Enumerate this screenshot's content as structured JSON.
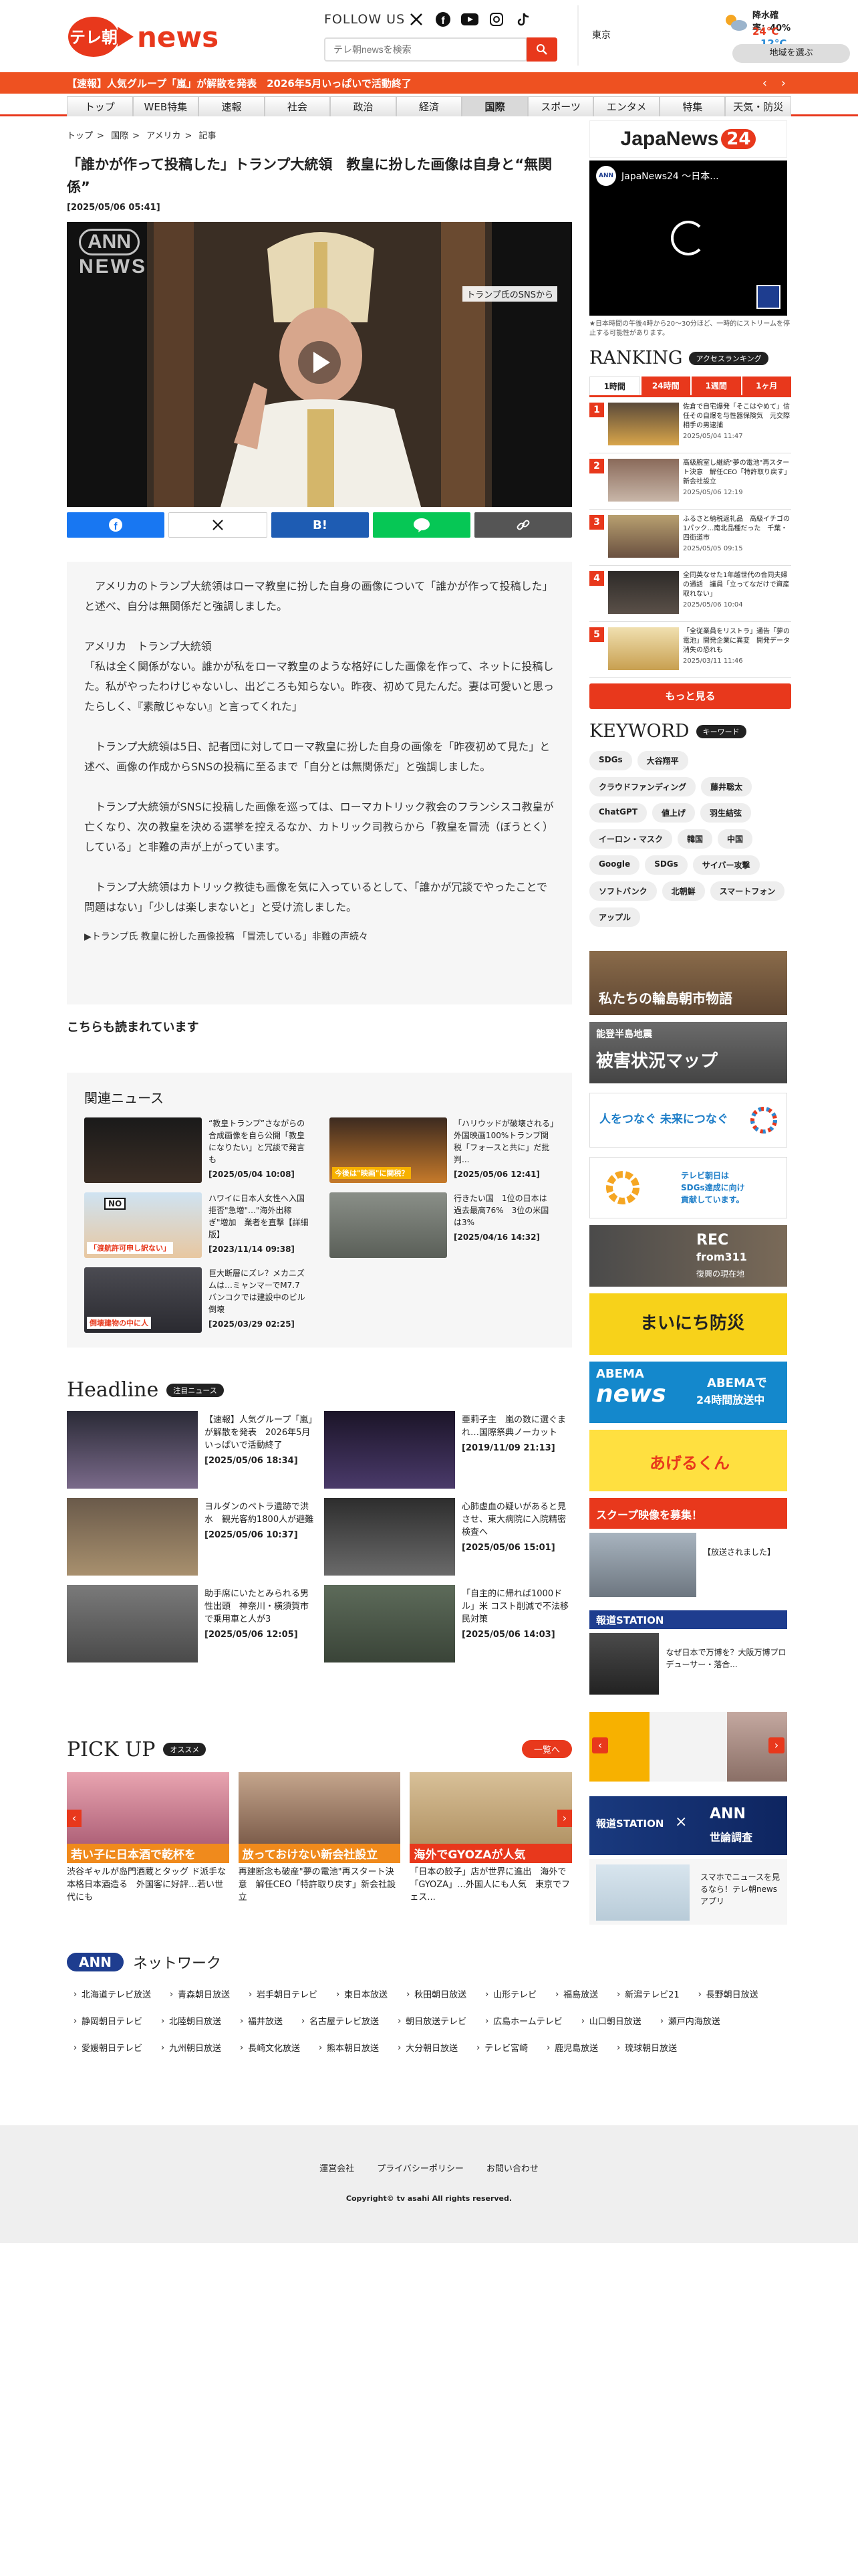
{
  "header": {
    "logo_text": "テレ朝",
    "logo_news": "news",
    "follow": "FOLLOW US",
    "search_placeholder": "テレ朝newsを検索",
    "weather": {
      "city": "東京",
      "rain_label": "降水確率：",
      "rain": "40%",
      "high": "24°C",
      "low": "12°C",
      "region_btn": "地域を選ぶ"
    }
  },
  "ticker": {
    "text": "【速報】人気グループ「嵐」が解散を発表　2026年5月いっぱいで活動終了"
  },
  "nav": [
    "トップ",
    "WEB特集",
    "速報",
    "社会",
    "政治",
    "経済",
    "国際",
    "スポーツ",
    "エンタメ",
    "特集",
    "天気・防災"
  ],
  "nav_active": "国際",
  "breadcrumb": [
    "トップ",
    "国際",
    "アメリカ",
    "記事"
  ],
  "article": {
    "title": "「誰かが作って投稿した」トランプ大統領　教皇に扮した画像は自身と“無関係”",
    "date": "[2025/05/06 05:41]",
    "video_logo": "ANN",
    "video_logo2": "NEWS",
    "video_caption": "トランプ氏のSNSから",
    "p1": "　アメリカのトランプ大統領はローマ教皇に扮した自身の画像について「誰かが作って投稿した」と述べ、自分は無関係だと強調しました。",
    "p2a": "アメリカ　トランプ大統領",
    "p2b": "「私は全く関係がない。誰かが私をローマ教皇のような格好にした画像を作って、ネットに投稿した。私がやったわけじゃないし、出どころも知らない。昨夜、初めて見たんだ。妻は可愛いと思ったらしく、『素敵じゃない』と言ってくれた」",
    "p3": "　トランプ大統領は5日、記者団に対してローマ教皇に扮した自身の画像を「昨夜初めて見た」と述べ、画像の作成からSNSの投稿に至るまで「自分とは無関係だ」と強調しました。",
    "p4": "　トランプ大統領がSNSに投稿した画像を巡っては、ローマカトリック教会のフランシスコ教皇が亡くなり、次の教皇を決める選挙を控えるなか、カトリック司教らから「教皇を冒涜（ぼうとく）している」と非難の声が上がっています。",
    "p5": "　トランプ大統領はカトリック教徒も画像を気に入っているとして、「誰かが冗談でやったことで問題はない」「少しは楽しまないと」と受け流しました。",
    "link": "▶トランプ氏 教皇に扮した画像投稿 「冒涜している」非難の声続々"
  },
  "also_read": "こちらも読まれています",
  "related": {
    "title": "関連ニュース",
    "items": [
      {
        "text": "“教皇トランプ”さながらの合成画像を自ら公開「教皇になりたい」と冗談で発言も",
        "date": "[2025/05/04 10:08]"
      },
      {
        "text": "「ハリウッドが破壊される」外国映画100%トランプ関税「フォースと共に」だ批判...",
        "date": "[2025/05/06 12:41]",
        "overlay": "今後は\"映画\"に関税？"
      },
      {
        "text": "ハワイに日本人女性へ入国拒否\"急増\"…\"海外出稼ぎ\"増加　業者を直撃【詳細版】",
        "date": "[2023/11/14 09:38]",
        "overlay": "「渡航許可申し訳ない」",
        "overlay2": "NO"
      },
      {
        "text": "行きたい国　1位の日本は過去最高76%　3位の米国は3%",
        "date": "[2025/04/16 14:32]",
        "overlay": ""
      },
      {
        "text": "巨大断層にズレ？メカニズムは…ミャンマーでM7.7　バンコクでは建設中のビル倒壊",
        "date": "[2025/03/29 02:25]",
        "overlay": "倒壊建物の中に人"
      }
    ]
  },
  "headline": {
    "title": "Headline",
    "badge": "注目ニュース",
    "items": [
      {
        "text": "【速報】人気グループ「嵐」が解散を発表　2026年5月いっぱいで活動終了",
        "date": "[2025/05/06 18:34]"
      },
      {
        "text": "亜莉子主　嵐の数に選ぐまれ…国際祭典ノーカット",
        "date": "[2019/11/09 21:13]"
      },
      {
        "text": "ヨルダンのペトラ遺跡で洪水　観光客約1800人が避難",
        "date": "[2025/05/06 10:37]"
      },
      {
        "text": "心肺虚血の疑いがあると見させ、東大病院に入院精密検査へ",
        "date": "[2025/05/06 15:01]"
      },
      {
        "text": "助手席にいたとみられる男性出頭　神奈川・横須賀市で乗用車と人が3",
        "date": "[2025/05/06 12:05]"
      },
      {
        "text": "「自主的に帰れば1000ドル」米 コスト削減で不法移民対策",
        "date": "[2025/05/06 14:03]"
      }
    ]
  },
  "pickup": {
    "title": "PICK UP",
    "badge": "オススメ",
    "more": "一覧へ",
    "items": [
      {
        "text": "渋谷ギャルが岛門酒蔵とタッグ ド派手な本格日本酒造る　外国客に好評…若い世代にも",
        "overlay": "若い子に日本酒で乾杯を"
      },
      {
        "text": "再建断念も破産\"夢の電池\"再スタート決意　解任CEO「特許取り戻す」新会社設立",
        "overlay": "放っておけない新会社設立"
      },
      {
        "text": "「日本の餃子」店が世界に進出　海外で「GYOZA」…外国人にも人気　東京でフェス...",
        "overlay": "海外でGYOZAが人気"
      }
    ]
  },
  "sidebar": {
    "jn_title": "JapaNews",
    "jn_num": "24",
    "jn_video": "JapaNews24 〜日本...",
    "jn_note": "★日本時間の午後4時から20〜30分ほど、一時的にストリームを停止する可能性があります。",
    "ranking": "RANKING",
    "ranking_badge": "アクセスランキング",
    "tabs": [
      "1時間",
      "24時間",
      "1週間",
      "1ヶ月"
    ],
    "ranks": [
      {
        "num": "1",
        "text": "佐倉で自宅爆発「そこはやめて」信任その自爆を与性器保険気　元交際相手の男逮捕",
        "date": "2025/05/04 11:47"
      },
      {
        "text": "高級腕室し継続\"夢の電池\"再スタート決意　解任CEO「特許取り戻す」新会社設立",
        "num": "2",
        "date": "2025/05/06 12:19"
      },
      {
        "num": "3",
        "text": "ふるさと納税返礼品　高級イチゴの1パック…南北品種だった　千葉・四街道市",
        "date": "2025/05/05 09:15"
      },
      {
        "num": "4",
        "text": "全同英なせた1年越世代の合同夫婦の通話　議員「立ってなだけで資産取れない」",
        "date": "2025/05/06 10:04"
      },
      {
        "num": "5",
        "text": "「全従業員をリストラ」通告「夢の電池」開発企業に異変　開発データ消失の恐れも",
        "date": "2025/03/11 11:46"
      }
    ],
    "more": "もっと見る",
    "keyword": "KEYWORD",
    "keyword_badge": "キーワード",
    "tags": [
      "SDGs",
      "大谷翔平",
      "クラウドファンディング",
      "藤井聡太",
      "ChatGPT",
      "値上げ",
      "羽生結弦",
      "イーロン・マスク",
      "韓国",
      "中国",
      "Google",
      "SDGs",
      "サイバー攻撃",
      "ソフトバンク",
      "北朝鮮",
      "スマートフォン",
      "アップル"
    ],
    "b1": "私たちの輪島朝市物語",
    "b2a": "能登半島地震",
    "b2b": "被害状況マップ",
    "b3": "人をつなぐ 未来につなぐ",
    "b4a": "テレビ朝日は",
    "b4b": "SDGs達成に向け",
    "b4c": "貢献しています。",
    "b5a": "REC",
    "b5b": "from311",
    "b5c": "復興の現在地",
    "b6": "まいにち防災",
    "b7a": "ABEMA",
    "b7b": "news",
    "b7c": "ABEMAで",
    "b7d": "24時間放送中",
    "b8": "あげるくん",
    "b9a": "スクープ映像を募集！",
    "b9b": "【放送されました】",
    "b10a": "報道STATION",
    "b10b": "なぜ日本で万博を？大阪万博プロデューサー・落合...",
    "b11a": "報道STATION",
    "b11b": "ANN",
    "b11c": "世論調査",
    "b12": "スマホでニュースを見るなら！テレ朝newsアプリ"
  },
  "network": {
    "title": "ネットワーク",
    "ann": "ANN",
    "items": [
      "北海道テレビ放送",
      "青森朝日放送",
      "岩手朝日テレビ",
      "東日本放送",
      "秋田朝日放送",
      "山形テレビ",
      "福島放送",
      "新潟テレビ21",
      "長野朝日放送",
      "静岡朝日テレビ",
      "北陸朝日放送",
      "福井放送",
      "名古屋テレビ放送",
      "朝日放送テレビ",
      "広島ホームテレビ",
      "山口朝日放送",
      "瀬戸内海放送",
      "愛媛朝日テレビ",
      "九州朝日放送",
      "長崎文化放送",
      "熊本朝日放送",
      "大分朝日放送",
      "テレビ宮崎",
      "鹿児島放送",
      "琉球朝日放送"
    ]
  },
  "footer": {
    "links": [
      "運営会社",
      "プライバシーポリシー",
      "お問い合わせ"
    ],
    "copyright": "Copyright© tv asahi All rights reserved."
  },
  "colors": {
    "accent": "#e8381c",
    "ticker": "#ee5121"
  }
}
